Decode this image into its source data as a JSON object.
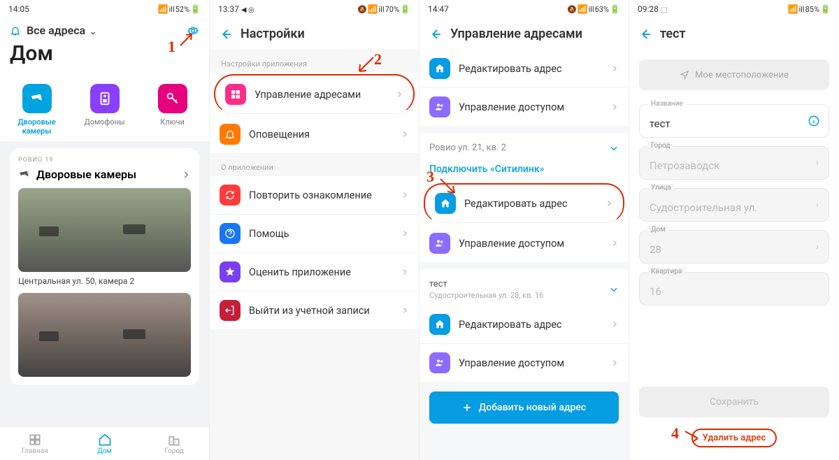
{
  "screen1": {
    "status": {
      "time": "14:05",
      "signal": "ill",
      "battery": "52%"
    },
    "all_addresses": "Все адреса",
    "title": "Дом",
    "cats": [
      {
        "label": "Дворовые камеры",
        "bg": "#00a3e0",
        "icon": "camera"
      },
      {
        "label": "Домофоны",
        "bg": "#8a3ffc",
        "icon": "intercom"
      },
      {
        "label": "Ключи",
        "bg": "#e6007e",
        "icon": "key"
      }
    ],
    "street": "РОВИО 19",
    "cam_section": "Дворовые камеры",
    "cam_caption": "Центральная ул. 50, камера 2",
    "nav": [
      "Главная",
      "Дом",
      "Город"
    ]
  },
  "screen2": {
    "status": {
      "time": "13:37",
      "left_icons": "◀ ◎",
      "signal": "ill",
      "battery": "70%"
    },
    "title": "Настройки",
    "section_app": "Настройки приложения",
    "section_about": "О приложении",
    "items_app": [
      {
        "label": "Управление адресами",
        "bg": "#ff2d87",
        "icon": "house-grid"
      },
      {
        "label": "Оповещения",
        "bg": "#ff7a00",
        "icon": "bell"
      }
    ],
    "items_about": [
      {
        "label": "Повторить ознакомление",
        "bg": "#ff3b3b",
        "icon": "refresh"
      },
      {
        "label": "Помощь",
        "bg": "#1877f2",
        "icon": "question"
      },
      {
        "label": "Оценить приложение",
        "bg": "#7b3ff0",
        "icon": "star"
      },
      {
        "label": "Выйти из учетной записи",
        "bg": "#c41e3a",
        "icon": "exit"
      }
    ]
  },
  "screen3": {
    "status": {
      "time": "14:47",
      "signal": "ill",
      "battery": "63%"
    },
    "title": "Управление адресами",
    "top_items": [
      {
        "label": "Редактировать адрес",
        "bg": "#069de2",
        "icon": "house"
      },
      {
        "label": "Управление доступом",
        "bg": "#8a6cff",
        "icon": "users"
      }
    ],
    "addr1": "Ровио ул. 21, кв. 2",
    "connect": "Подключить «Ситилинк»",
    "addr1_items": [
      {
        "label": "Редактировать адрес",
        "bg": "#069de2",
        "icon": "house"
      },
      {
        "label": "Управление доступом",
        "bg": "#8a6cff",
        "icon": "users"
      }
    ],
    "addr2_title": "тест",
    "addr2_sub": "Судостроительная ул. 28, кв. 16",
    "addr2_items": [
      {
        "label": "Редактировать адрес",
        "bg": "#069de2",
        "icon": "house"
      },
      {
        "label": "Управление доступом",
        "bg": "#8a6cff",
        "icon": "users"
      }
    ],
    "add_btn": "Добавить новый адрес"
  },
  "screen4": {
    "status": {
      "time": "09:28",
      "left_icons": "⬚",
      "signal": "ill",
      "battery": "85%"
    },
    "title": "тест",
    "loc_btn": "Мое местоположение",
    "fields": {
      "name_label": "Название",
      "name_val": "тест",
      "city_label": "Город",
      "city_val": "Петрозаводск",
      "street_label": "Улица",
      "street_val": "Судостроительная ул.",
      "house_label": "Дом",
      "house_val": "28",
      "apt_label": "Квартира",
      "apt_val": "16"
    },
    "save": "Сохранить",
    "delete": "Удалить адрес"
  },
  "annotations": {
    "n1": "1",
    "n2": "2",
    "n3": "3",
    "n4": "4"
  }
}
